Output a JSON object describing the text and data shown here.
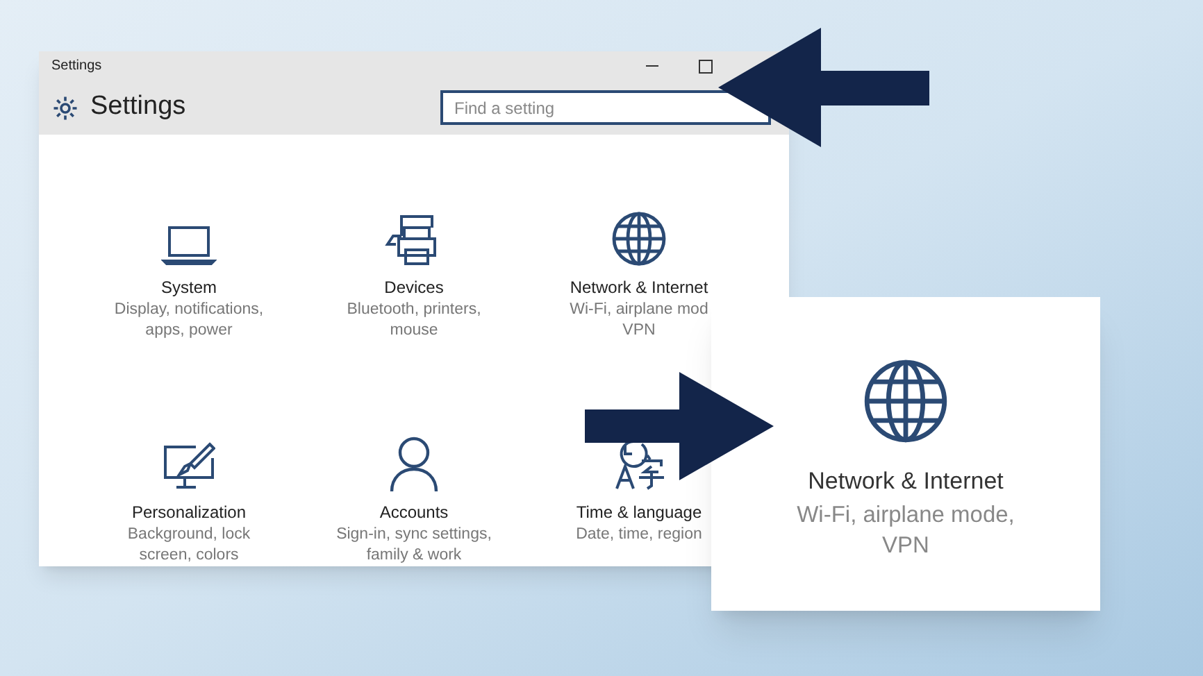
{
  "window": {
    "title": "Settings"
  },
  "header": {
    "title": "Settings"
  },
  "search": {
    "placeholder": "Find a setting"
  },
  "categories": [
    {
      "title": "System",
      "description": "Display, notifications, apps, power"
    },
    {
      "title": "Devices",
      "description": "Bluetooth, printers, mouse"
    },
    {
      "title": "Network & Internet",
      "description": "Wi-Fi, airplane mod VPN"
    },
    {
      "title": "Personalization",
      "description": "Background, lock screen, colors"
    },
    {
      "title": "Accounts",
      "description": "Sign-in, sync settings, family & work"
    },
    {
      "title": "Time & language",
      "description": "Date, time, region"
    }
  ],
  "zoom_card": {
    "title": "Network & Internet",
    "description": "Wi-Fi, airplane mode, VPN"
  }
}
